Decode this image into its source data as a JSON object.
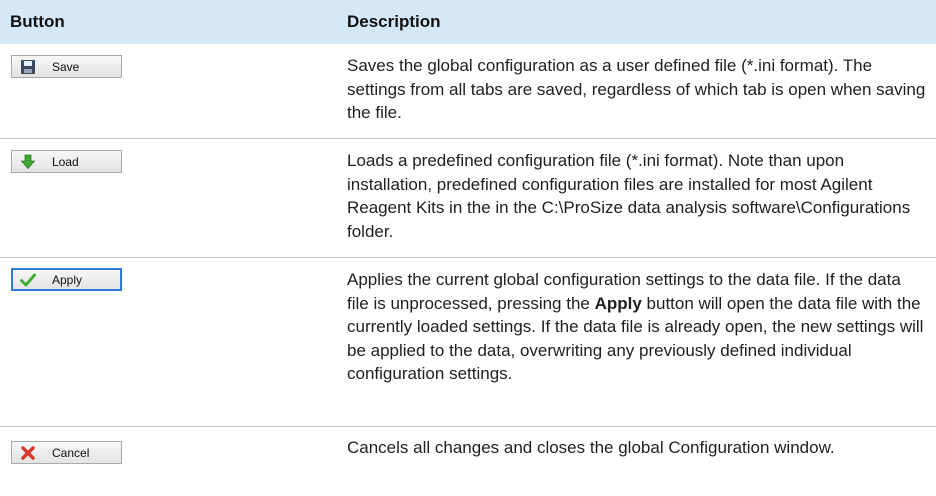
{
  "header": {
    "button": "Button",
    "description": "Description"
  },
  "rows": [
    {
      "button": {
        "label": "Save",
        "icon": "floppy-disk-icon"
      },
      "text": "Saves the global configuration as a user defined file (*.ini format). The settings from all tabs are saved, regardless of which tab is open when saving the file."
    },
    {
      "button": {
        "label": "Load",
        "icon": "green-down-arrow-icon"
      },
      "text": "Loads a predefined configuration file (*.ini format). Note than upon installation, predefined configuration files are installed for most Agilent Reagent Kits in the in the C:\\ProSize data analysis software\\Configurations folder."
    },
    {
      "button": {
        "label": "Apply",
        "icon": "green-checkmark-icon"
      },
      "text_before": "Applies the current global configuration settings to the data file. If the data file is unprocessed, pressing the ",
      "bold": "Apply",
      "text_after": " button will open the data file with the currently loaded settings. If the data file is already open, the new settings will be applied to the data, overwriting any previously defined individual configuration settings."
    },
    {
      "button": {
        "label": "Cancel",
        "icon": "red-x-icon"
      },
      "text": "Cancels all changes and closes the global Configuration window."
    }
  ]
}
